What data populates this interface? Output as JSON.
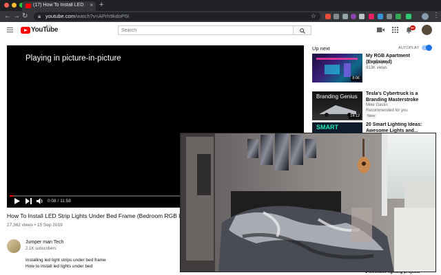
{
  "browser": {
    "tab_title": "(17) How To Install LED Strip",
    "tab_close": "×",
    "new_tab": "+",
    "url_host": "youtube.com",
    "url_path": "/watch?v=APrh9kdoP6I"
  },
  "youtube": {
    "logo_text": "YouTube",
    "region": "AU",
    "search_placeholder": "Search",
    "notification_count": "9+"
  },
  "player": {
    "pip_message": "Playing in picture-in-picture",
    "time": "0:08 / 11:58",
    "progress_fraction": 0.011
  },
  "video": {
    "title": "How To Install LED Strip Lights Under Bed Frame (Bedroom RGB lighting)",
    "meta": "27,362 views • 15 Sep 2019",
    "channel_name": "Jumper man Tech",
    "channel_subs": "2.1K subscribers",
    "description": [
      "Installing led light strips under bed frame",
      "How to install led lights under bed"
    ]
  },
  "sidebar": {
    "up_next": "Up next",
    "autoplay_label": "AUTOPLAY",
    "autoplay_on": true,
    "items": [
      {
        "title": "My RGB Apartment (Explained)",
        "channel": "Coltography",
        "meta": "913K views",
        "duration": "8:06",
        "badge": ""
      },
      {
        "title": "Tesla's Cybertruck is a Branding Masterstroke",
        "channel": "Mike Gastin",
        "meta": "Recommended for you",
        "duration": "14:12",
        "badge": "New",
        "thumb_text": "Branding Genius"
      },
      {
        "title": "20 Smart Lighting Ideas: Awesome Lights and...",
        "channel": "",
        "meta": "",
        "duration": "",
        "badge": "",
        "thumb_text": "SMART"
      }
    ],
    "bottom_peek": "3 inventive lighting projects"
  }
}
